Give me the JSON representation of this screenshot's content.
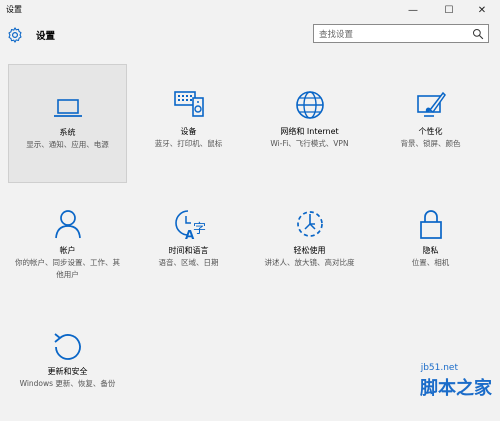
{
  "window": {
    "title": "设置",
    "min_glyph": "—",
    "max_glyph": "☐",
    "close_glyph": "✕"
  },
  "header": {
    "title": "设置"
  },
  "search": {
    "placeholder": "查找设置"
  },
  "accent_color": "#0a66c7",
  "tiles": [
    {
      "name": "系统",
      "desc": "显示、通知、应用、电源",
      "icon": "laptop-icon",
      "selected": true
    },
    {
      "name": "设备",
      "desc": "蓝牙、打印机、鼠标",
      "icon": "devices-icon"
    },
    {
      "name": "网络和 Internet",
      "desc": "Wi-Fi、飞行模式、VPN",
      "icon": "globe-icon"
    },
    {
      "name": "个性化",
      "desc": "背景、锁屏、颜色",
      "icon": "personalization-icon"
    },
    {
      "name": "帐户",
      "desc": "你的帐户、同步设置、工作、其他用户",
      "icon": "person-icon"
    },
    {
      "name": "时间和语言",
      "desc": "语音、区域、日期",
      "icon": "time-language-icon"
    },
    {
      "name": "轻松使用",
      "desc": "讲述人、放大镜、高对比度",
      "icon": "ease-of-access-icon"
    },
    {
      "name": "隐私",
      "desc": "位置、相机",
      "icon": "lock-icon"
    },
    {
      "name": "更新和安全",
      "desc": "Windows 更新、恢复、备份",
      "icon": "update-icon"
    }
  ],
  "watermark": {
    "url": "jb51.net",
    "text": "脚本之家"
  }
}
